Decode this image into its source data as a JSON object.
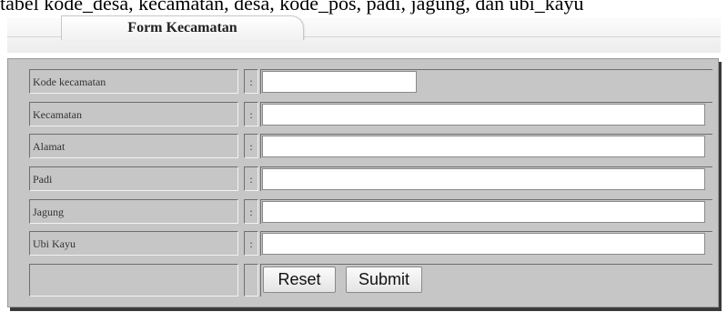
{
  "caption": "tabel kode_desa, kecamatan, desa, kode_pos, padi, jagung, dan ubi_kayu",
  "form": {
    "tab_title": "Form Kecamatan",
    "separator": ":",
    "fields": [
      {
        "label": "Kode kecamatan",
        "value": ""
      },
      {
        "label": "Kecamatan",
        "value": ""
      },
      {
        "label": "Alamat",
        "value": ""
      },
      {
        "label": "Padi",
        "value": ""
      },
      {
        "label": "Jagung",
        "value": ""
      },
      {
        "label": "Ubi Kayu",
        "value": ""
      }
    ],
    "buttons": {
      "reset_label": "Reset",
      "submit_label": "Submit"
    }
  }
}
